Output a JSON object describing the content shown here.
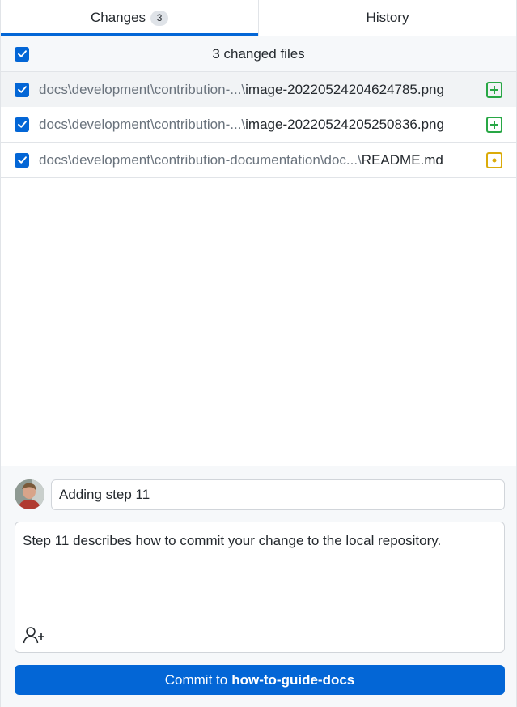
{
  "tabs": [
    {
      "label": "Changes",
      "count": "3",
      "active": true
    },
    {
      "label": "History",
      "active": false
    }
  ],
  "files_header": {
    "title": "3 changed files",
    "checked": true
  },
  "files": [
    {
      "prefix": "docs\\development\\contribution-...\\",
      "name": "image-20220524204624785.png",
      "status": "added",
      "checked": true,
      "selected": true
    },
    {
      "prefix": "docs\\development\\contribution-...\\",
      "name": "image-20220524205250836.png",
      "status": "added",
      "checked": true,
      "selected": false
    },
    {
      "prefix": "docs\\development\\contribution-documentation\\doc...\\",
      "name": "README.md",
      "status": "modified",
      "checked": true,
      "selected": false
    }
  ],
  "commit": {
    "summary": "Adding step 11",
    "description": "Step 11 describes how to commit your change to the local repository.",
    "button_prefix": "Commit to",
    "branch": "how-to-guide-docs"
  },
  "colors": {
    "accent": "#0366d6",
    "added": "#28a745",
    "modified": "#dbab09"
  },
  "icons": {
    "checkbox": "check-icon",
    "added": "diff-added-icon",
    "modified": "diff-modified-icon",
    "coauthor": "person-add-icon"
  }
}
